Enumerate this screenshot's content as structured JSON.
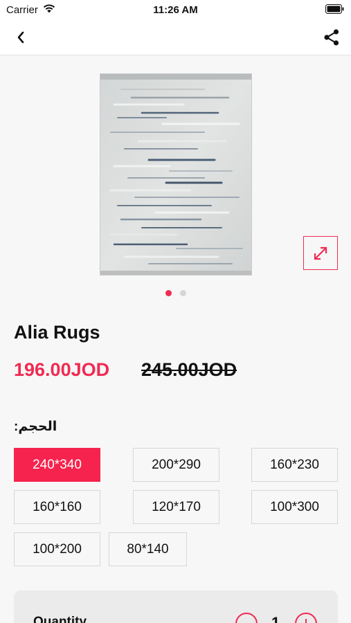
{
  "status_bar": {
    "carrier": "Carrier",
    "time": "11:26 AM",
    "icons": [
      "wifi-icon",
      "battery-icon"
    ]
  },
  "nav": {
    "back_icon": "chevron-left-icon",
    "share_icon": "share-icon"
  },
  "gallery": {
    "image_count": 2,
    "active_index": 0,
    "expand_icon": "expand-arrows-icon"
  },
  "product": {
    "title": "Alia Rugs",
    "price": "196.00JOD",
    "old_price": "245.00JOD"
  },
  "size": {
    "label": "الحجم:",
    "selected": "240*340",
    "options": [
      "240*340",
      "200*290",
      "160*230",
      "160*160",
      "120*170",
      "100*300",
      "100*200",
      "80*140"
    ]
  },
  "quantity": {
    "label": "Quantity",
    "value": "1"
  },
  "colors": {
    "accent": "#ef2b52",
    "selected_bg": "#f6234e",
    "page_bg": "#f7f7f7"
  }
}
